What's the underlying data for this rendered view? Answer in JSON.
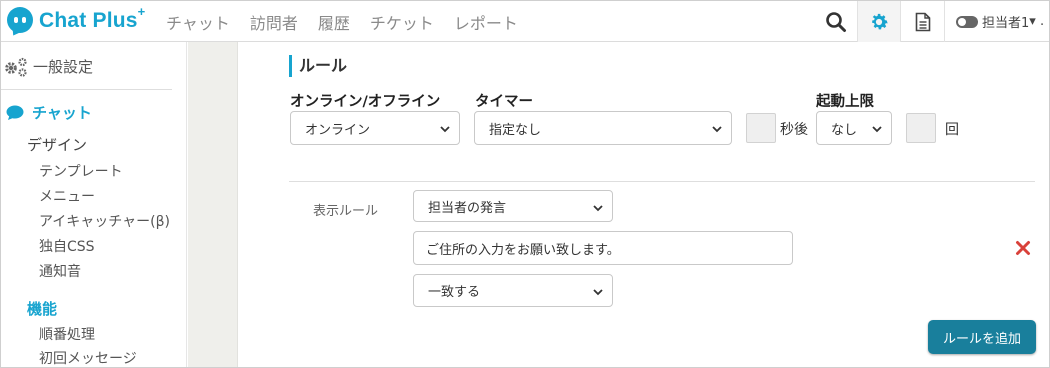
{
  "app": {
    "logo_text": "Chat Plus",
    "logo_plus": "+"
  },
  "nav": {
    "items": [
      {
        "label": "チャット"
      },
      {
        "label": "訪問者"
      },
      {
        "label": "履歴"
      },
      {
        "label": "チケット"
      },
      {
        "label": "レポート"
      }
    ]
  },
  "toolbar": {
    "user_label": "担当者1",
    "user_suffix": "▾ .",
    "accent": "#17a4cf"
  },
  "sidebar": {
    "general": "一般設定",
    "chat": "チャット",
    "design": "デザイン",
    "design_items": [
      {
        "label": "テンプレート"
      },
      {
        "label": "メニュー"
      },
      {
        "label": "アイキャッチャー(β)"
      },
      {
        "label": "独自CSS"
      },
      {
        "label": "通知音"
      }
    ],
    "function": "機能",
    "function_items": [
      {
        "label": "順番処理"
      },
      {
        "label": "初回メッセージ"
      }
    ]
  },
  "main": {
    "section_title": "ルール",
    "online_label": "オンライン/オフライン",
    "online_value": "オンライン",
    "timer_label": "タイマー",
    "timer_value": "指定なし",
    "seconds_after": "秒後",
    "limit_label": "起動上限",
    "limit_value": "なし",
    "times_unit": "回",
    "display_rule_label": "表示ルール",
    "rule_target_value": "担当者の発言",
    "rule_text_value": "ご住所の入力をお願い致します。",
    "rule_match_value": "一致する",
    "add_rule_button": "ルールを追加"
  }
}
